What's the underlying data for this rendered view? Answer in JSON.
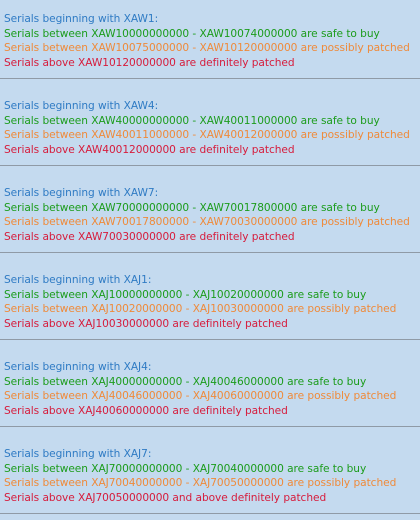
{
  "sections": [
    {
      "heading": "Serials beginning with XAW1:",
      "safe": "Serials between XAW10000000000 - XAW10074000000 are safe to buy",
      "possible": "Serials between XAW10075000000 - XAW10120000000 are possibly patched",
      "patched": "Serials above XAW10120000000 are definitely patched"
    },
    {
      "heading": "Serials beginning with XAW4:",
      "safe": "Serials between XAW40000000000 - XAW40011000000 are safe to buy",
      "possible": "Serials between XAW40011000000 - XAW40012000000 are possibly patched",
      "patched": "Serials above XAW40012000000 are definitely patched"
    },
    {
      "heading": "Serials beginning with XAW7:",
      "safe": "Serials between XAW70000000000 - XAW70017800000 are safe to buy",
      "possible": "Serials between XAW70017800000 - XAW70030000000 are possibly patched",
      "patched": "Serials above XAW70030000000 are definitely patched"
    },
    {
      "heading": "Serials beginning with XAJ1:",
      "safe": "Serials between XAJ10000000000 - XAJ10020000000 are safe to buy",
      "possible": "Serials between XAJ10020000000 - XAJ10030000000 are possibly patched",
      "patched": "Serials above XAJ10030000000 are definitely patched"
    },
    {
      "heading": "Serials beginning with XAJ4:",
      "safe": "Serials between XAJ40000000000 - XAJ40046000000 are safe to buy",
      "possible": "Serials between XAJ40046000000 - XAJ40060000000 are possibly patched",
      "patched": "Serials above XAJ40060000000 are definitely patched"
    },
    {
      "heading": "Serials beginning with XAJ7:",
      "safe": "Serials between XAJ70000000000 - XAJ70040000000 are safe to buy",
      "possible": "Serials between XAJ70040000000 - XAJ70050000000 are possibly patched",
      "patched": "Serials above XAJ70050000000 and above definitely patched"
    }
  ],
  "colors": {
    "background": "#c4daef",
    "heading": "#2f7bc4",
    "safe": "#1c9c1c",
    "possible": "#ef8a3a",
    "patched": "#d61c3c",
    "divider": "#8f9aa6"
  }
}
